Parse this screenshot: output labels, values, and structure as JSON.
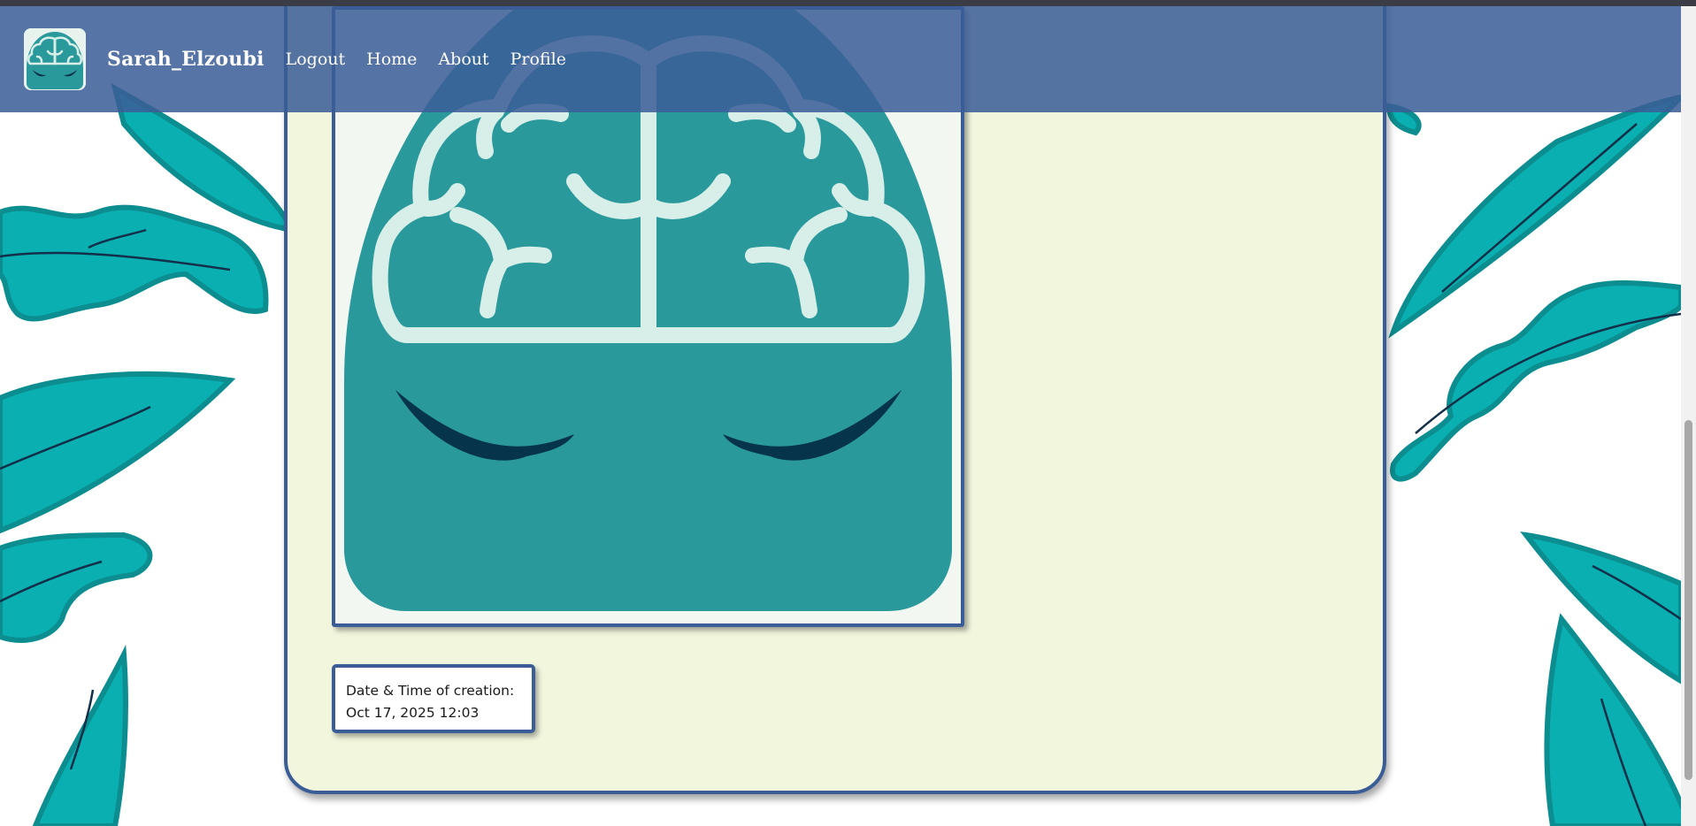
{
  "navbar": {
    "logo": "brain-logo-icon",
    "brand": "Sarah_Elzoubi",
    "links": [
      "Logout",
      "Home",
      "About",
      "Profile"
    ]
  },
  "post": {
    "image": "brain-logo-image",
    "date_label": "Date & Time of creation:",
    "date_value": "Oct 17, 2025 12:03"
  },
  "colors": {
    "navbar": "#3b5d97",
    "card_background": "#f1f6dd",
    "border": "#3b5d97",
    "logo_teal": "#2a999b",
    "leaf_teal": "#0aafb1"
  }
}
